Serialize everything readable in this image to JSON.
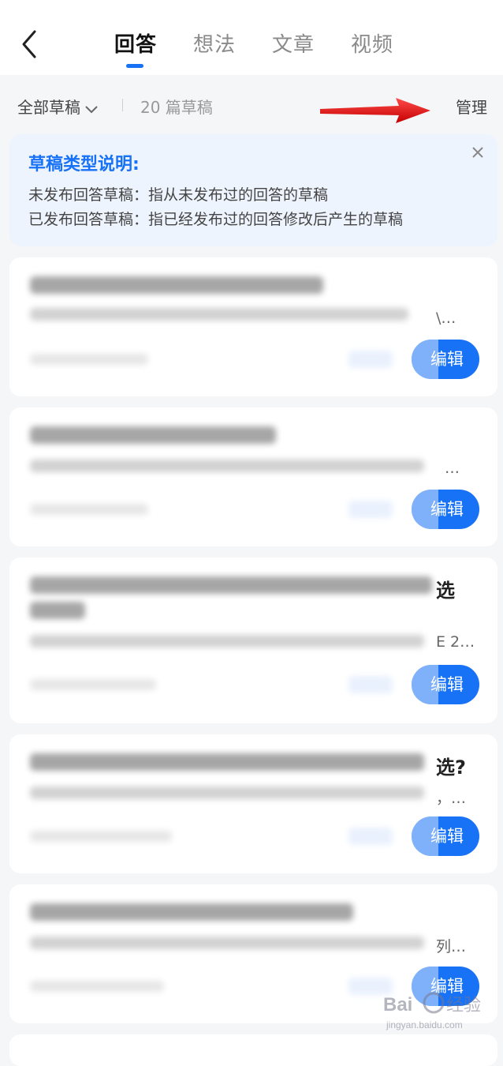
{
  "header": {
    "tabs": [
      "回答",
      "想法",
      "文章",
      "视频"
    ]
  },
  "filter": {
    "label": "全部草稿",
    "count": "20 篇草稿",
    "manage": "管理"
  },
  "info": {
    "title": "草稿类型说明:",
    "line1": "未发布回答草稿：指从未发布过的回答的草稿",
    "line2": "已发布回答草稿：指已经发布过的回答修改后产生的草稿"
  },
  "drafts": [
    {
      "peek_title": "",
      "peek_excerpt": "\\…",
      "edit": "编辑"
    },
    {
      "peek_title": "",
      "peek_excerpt": "…",
      "edit": "编辑"
    },
    {
      "peek_title": "选",
      "peek_excerpt": "E 2…",
      "edit": "编辑"
    },
    {
      "peek_title": "选?",
      "peek_excerpt": "，…",
      "edit": "编辑"
    },
    {
      "peek_title": "",
      "peek_excerpt": "列…",
      "edit": "编辑"
    }
  ],
  "watermark": "Baidu经验 jingyan.baidu.com",
  "colors": {
    "accent": "#1772f6",
    "arrow": "#e11a1a"
  }
}
